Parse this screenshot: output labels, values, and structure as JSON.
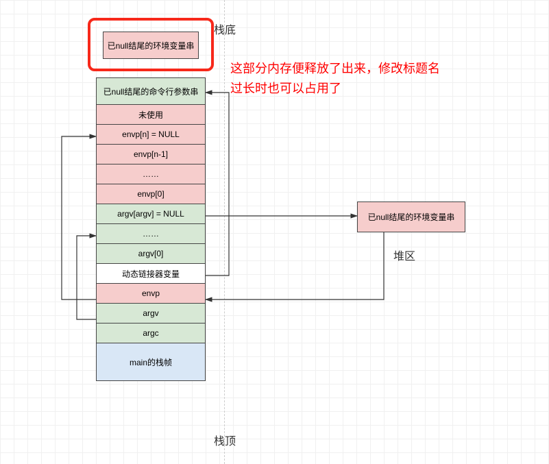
{
  "labels": {
    "stack_bottom": "栈底",
    "stack_top": "栈顶",
    "heap_area": "堆区"
  },
  "annotation": {
    "line1": "这部分内存便释放了出来，修改标题名",
    "line2": "过长时也可以占用了"
  },
  "top_highlight_cell": "已null结尾的环境变量串",
  "stack_cells": [
    {
      "text": "已null结尾的命令行参数串",
      "color": "green",
      "height": "h40"
    },
    {
      "text": "未使用",
      "color": "pink",
      "height": "h30"
    },
    {
      "text": "envp[n] = NULL",
      "color": "pink",
      "height": "h30"
    },
    {
      "text": "envp[n-1]",
      "color": "pink",
      "height": "h30"
    },
    {
      "text": "……",
      "color": "pink",
      "height": "h30"
    },
    {
      "text": "envp[0]",
      "color": "pink",
      "height": "h30"
    },
    {
      "text": "argv[argv] = NULL",
      "color": "green",
      "height": "h30"
    },
    {
      "text": "……",
      "color": "green",
      "height": "h30"
    },
    {
      "text": "argv[0]",
      "color": "green",
      "height": "h30"
    },
    {
      "text": "动态链接器变量",
      "color": "white",
      "height": "h30"
    },
    {
      "text": "envp",
      "color": "pink",
      "height": "h30"
    },
    {
      "text": "argv",
      "color": "green",
      "height": "h30"
    },
    {
      "text": "argc",
      "color": "green",
      "height": "h30"
    },
    {
      "text": "main的栈帧",
      "color": "blue",
      "height": "h56"
    }
  ],
  "heap_cell": "已null结尾的环境变量串"
}
